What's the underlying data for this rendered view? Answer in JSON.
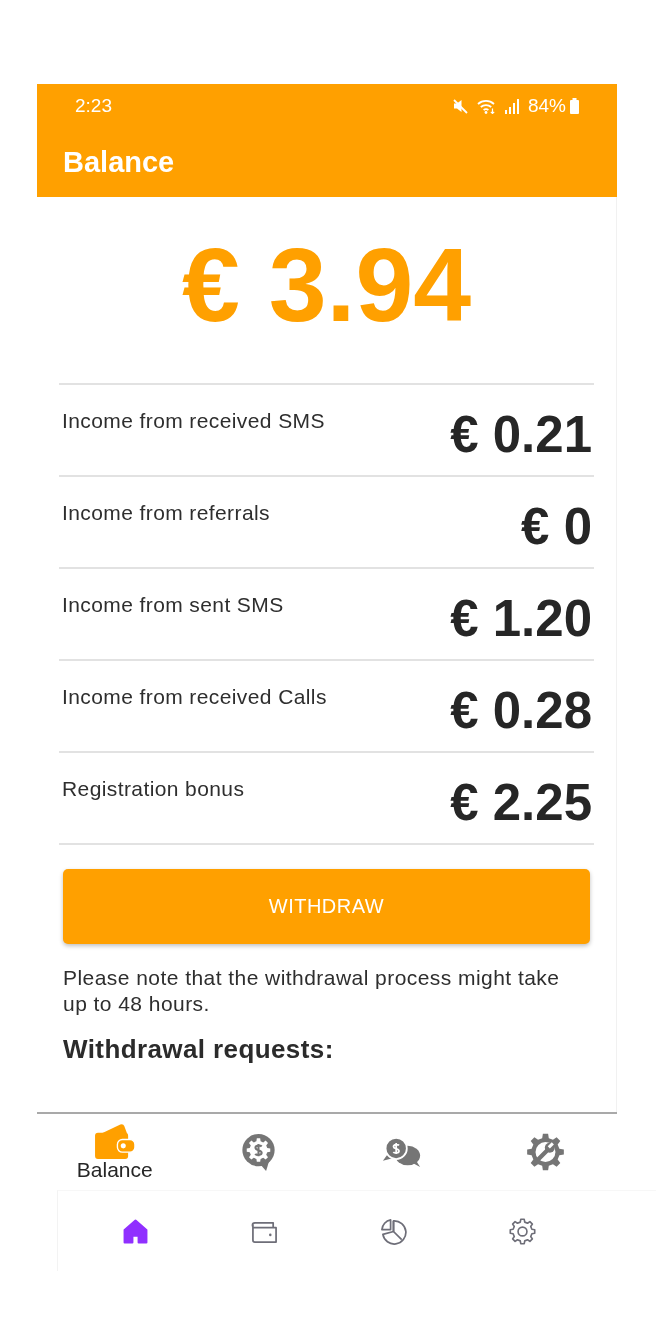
{
  "status_bar": {
    "time": "2:23",
    "battery": "84%"
  },
  "app_bar": {
    "title": "Balance"
  },
  "balance": {
    "amount": "€ 3.94"
  },
  "income_rows": [
    {
      "label": "Income from received SMS",
      "amount": "€ 0.21"
    },
    {
      "label": "Income from referrals",
      "amount": "€ 0"
    },
    {
      "label": "Income from sent SMS",
      "amount": "€ 1.20"
    },
    {
      "label": "Income from received Calls",
      "amount": "€ 0.28"
    },
    {
      "label": "Registration bonus",
      "amount": "€ 2.25"
    }
  ],
  "withdraw_button": {
    "label": "WITHDRAW"
  },
  "note": "Please note that the withdrawal process might take up to 48 hours.",
  "requests_heading": "Withdrawal requests:",
  "bottom_nav": {
    "items": [
      {
        "label": "Balance",
        "selected": true
      },
      {
        "selected": false
      },
      {
        "selected": false
      },
      {
        "selected": false
      }
    ]
  },
  "system_nav": {
    "items": [
      {
        "selected": true
      },
      {
        "selected": false
      },
      {
        "selected": false
      },
      {
        "selected": false
      }
    ]
  }
}
